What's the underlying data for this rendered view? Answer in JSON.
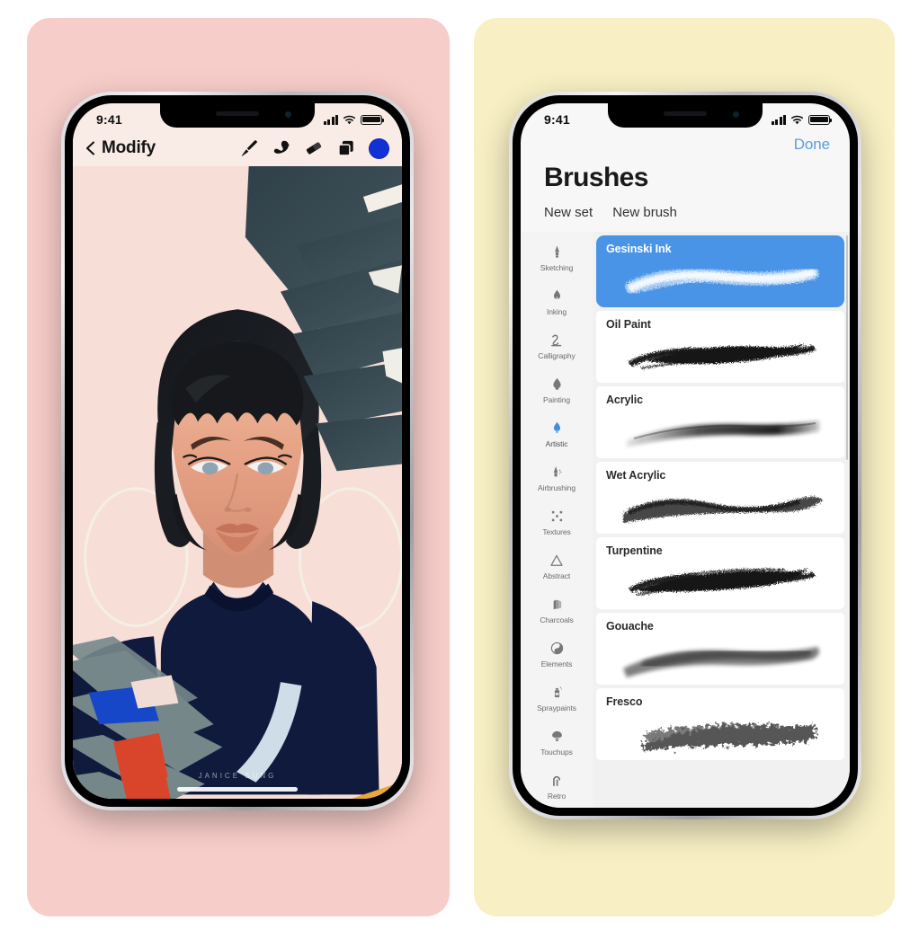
{
  "cards": {
    "left_bg": "#f7cdc9",
    "right_bg": "#f8f0c4"
  },
  "left_phone": {
    "status": {
      "time": "9:41",
      "signal_icon": "signal-bars-icon",
      "wifi_icon": "wifi-icon",
      "battery_icon": "battery-icon"
    },
    "nav": {
      "back_icon": "chevron-left-icon",
      "title": "Modify",
      "tools": [
        {
          "name": "brush-tool-icon",
          "label": "Brush"
        },
        {
          "name": "smudge-tool-icon",
          "label": "Smudge"
        },
        {
          "name": "eraser-tool-icon",
          "label": "Eraser"
        },
        {
          "name": "layers-tool-icon",
          "label": "Layers"
        }
      ],
      "color_swatch": "#1230d8",
      "color_label": "Color"
    },
    "canvas": {
      "name": "artwork-canvas",
      "background": "#f7ded7",
      "watermark": "JANICE SUNG",
      "palette": {
        "skin": "#e9a98c",
        "hair": "#17191c",
        "slate": "#36474f",
        "navy": "#101a3d",
        "gray_strokes": "#76878a",
        "red": "#d8452a",
        "blue": "#1547c8",
        "yellow": "#e8a93a",
        "pale_blue": "#cfdde8"
      }
    },
    "home_indicator": "home-indicator"
  },
  "right_phone": {
    "status": {
      "time": "9:41",
      "signal_icon": "signal-bars-icon",
      "wifi_icon": "wifi-icon",
      "battery_icon": "battery-icon"
    },
    "done_label": "Done",
    "done_color": "#5a9ee6",
    "title": "Brushes",
    "actions": [
      {
        "label": "New set",
        "name": "new-set-button"
      },
      {
        "label": "New brush",
        "name": "new-brush-button"
      }
    ],
    "categories": [
      {
        "label": "Sketching",
        "icon": "pencil-icon",
        "active": false
      },
      {
        "label": "Inking",
        "icon": "ink-pen-icon",
        "active": false
      },
      {
        "label": "Calligraphy",
        "icon": "calligraphy-icon",
        "active": false
      },
      {
        "label": "Painting",
        "icon": "paint-drop-icon",
        "active": false
      },
      {
        "label": "Artistic",
        "icon": "artistic-icon",
        "active": true
      },
      {
        "label": "Airbrushing",
        "icon": "airbrush-icon",
        "active": false
      },
      {
        "label": "Textures",
        "icon": "textures-icon",
        "active": false
      },
      {
        "label": "Abstract",
        "icon": "triangle-icon",
        "active": false
      },
      {
        "label": "Charcoals",
        "icon": "charcoal-icon",
        "active": false
      },
      {
        "label": "Elements",
        "icon": "yin-yang-icon",
        "active": false
      },
      {
        "label": "Spraypaints",
        "icon": "spray-can-icon",
        "active": false
      },
      {
        "label": "Touchups",
        "icon": "touchup-icon",
        "active": false
      },
      {
        "label": "Retro",
        "icon": "retro-icon",
        "active": false
      }
    ],
    "selected_brush": "Gesinski Ink",
    "selected_color": "#4a94e8",
    "brushes": [
      {
        "name": "Gesinski Ink",
        "stroke": "dry-fine-streaks",
        "selected": true
      },
      {
        "name": "Oil Paint",
        "stroke": "heavy-dark-smear",
        "selected": false
      },
      {
        "name": "Acrylic",
        "stroke": "smooth-gradient",
        "selected": false
      },
      {
        "name": "Wet Acrylic",
        "stroke": "wavy-soft-band",
        "selected": false
      },
      {
        "name": "Turpentine",
        "stroke": "bristly-dark-drag",
        "selected": false
      },
      {
        "name": "Gouache",
        "stroke": "soft-cloudy-band",
        "selected": false
      },
      {
        "name": "Fresco",
        "stroke": "grainy-rough-patch",
        "selected": false
      }
    ]
  }
}
